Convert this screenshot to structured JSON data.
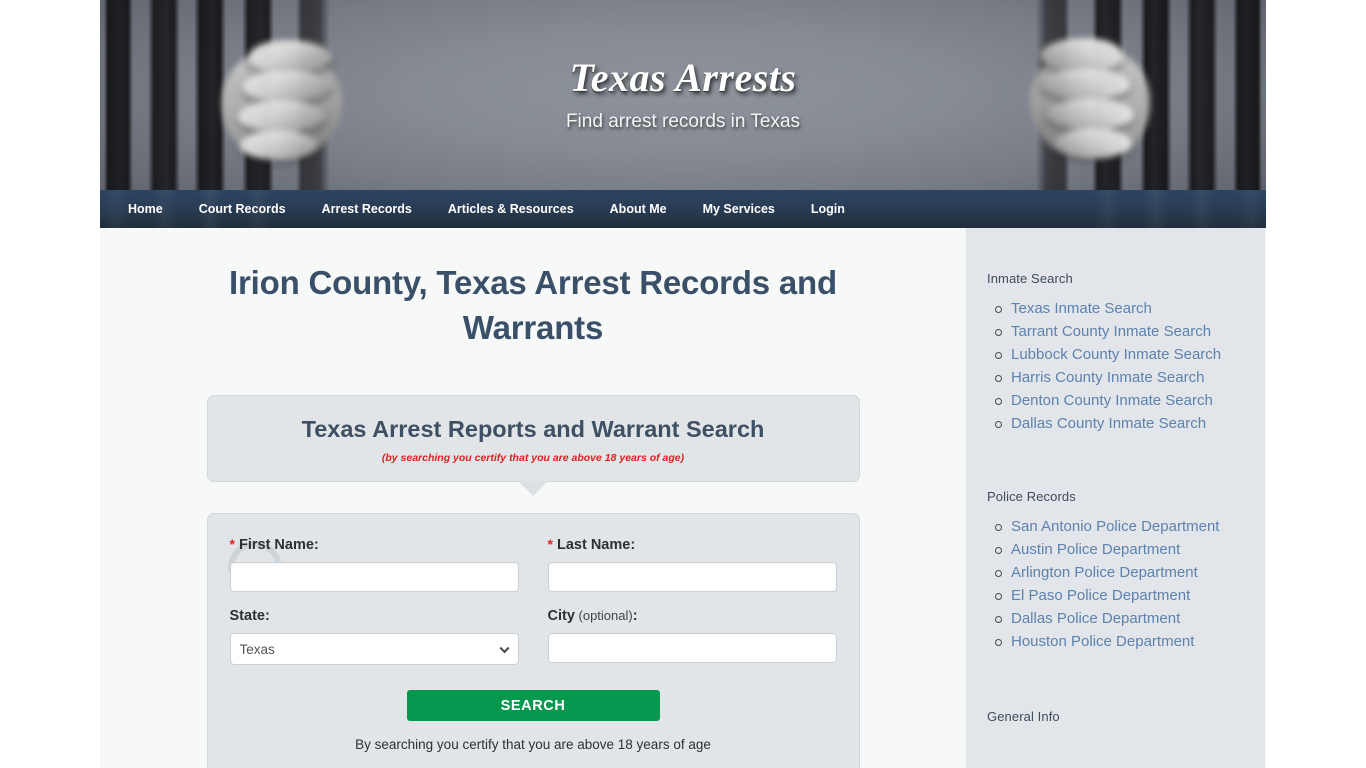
{
  "site": {
    "title": "Texas Arrests",
    "tagline": "Find arrest records in Texas"
  },
  "nav": {
    "items": [
      {
        "label": "Home"
      },
      {
        "label": "Court Records"
      },
      {
        "label": "Arrest Records"
      },
      {
        "label": "Articles & Resources"
      },
      {
        "label": "About Me"
      },
      {
        "label": "My Services"
      },
      {
        "label": "Login"
      }
    ]
  },
  "main": {
    "page_title": "Irion County, Texas Arrest Records and Warrants",
    "search_header": {
      "heading": "Texas Arrest Reports and Warrant Search",
      "disclaimer": "(by searching you certify that you are above 18 years of age)"
    },
    "form": {
      "first_name": {
        "label": "First Name:",
        "required_mark": "*",
        "value": "",
        "placeholder": ""
      },
      "last_name": {
        "label": "Last Name:",
        "required_mark": "*",
        "value": "",
        "placeholder": ""
      },
      "state": {
        "label": "State:",
        "value": "Texas",
        "options": [
          "Texas"
        ]
      },
      "city": {
        "label": "City",
        "optional_label": " (optional)",
        "suffix": ":",
        "value": "",
        "placeholder": ""
      },
      "submit_label": "SEARCH",
      "certify_note": "By searching you certify that you are above 18 years of age"
    }
  },
  "sidebar": {
    "widgets": [
      {
        "title": "Inmate Search",
        "links": [
          {
            "label": "Texas Inmate Search"
          },
          {
            "label": "Tarrant County Inmate Search"
          },
          {
            "label": "Lubbock County Inmate Search"
          },
          {
            "label": "Harris County Inmate Search"
          },
          {
            "label": "Denton County Inmate Search"
          },
          {
            "label": "Dallas County Inmate Search"
          }
        ]
      },
      {
        "title": "Police Records",
        "links": [
          {
            "label": "San Antonio Police Department"
          },
          {
            "label": "Austin Police Department"
          },
          {
            "label": "Arlington Police Department"
          },
          {
            "label": "El Paso Police Department"
          },
          {
            "label": "Dallas Police Department"
          },
          {
            "label": "Houston Police Department"
          }
        ]
      },
      {
        "title": "General Info",
        "links": []
      }
    ]
  },
  "colors": {
    "nav_bg": "#2b3e58",
    "heading": "#3a5068",
    "link": "#5d82ae",
    "accent_green": "#06984f",
    "required_red": "#e02020",
    "sidebar_bg": "#e2e6ea",
    "panel_bg": "#e1e5e8",
    "content_bg": "#f7f9f9"
  }
}
